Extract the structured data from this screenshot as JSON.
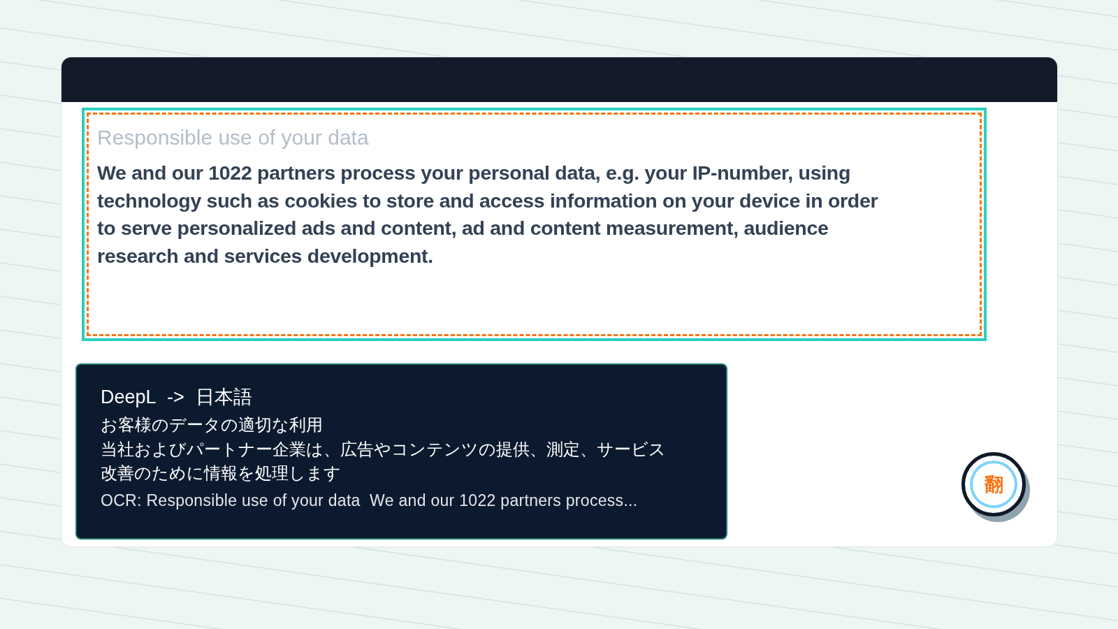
{
  "capture_region": {
    "heading": "Responsible use of your data",
    "body": "We and our 1022 partners process your personal data, e.g. your IP-number, using technology such as cookies to store and access information on your device in order to serve personalized ads and content, ad and content measurement, audience research and services development."
  },
  "translation_panel": {
    "title": "DeepL -> 日本語",
    "heading": "お客様のデータの適切な利用",
    "body": "当社およびパートナー企業は、広告やコンテンツの提供、測定、サービス改善のために情報を処理します",
    "ocr": "OCR: Responsible use of your data  We and our 1022 partners process..."
  },
  "translate_button": {
    "label": "翻"
  }
}
